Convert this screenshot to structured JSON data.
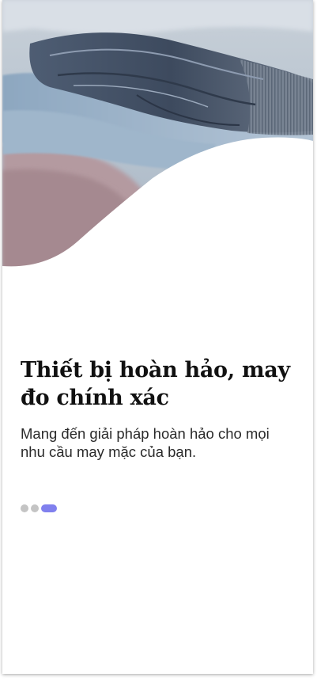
{
  "onboarding": {
    "title": "Thiết bị hoàn hảo, may đo chính xác",
    "subtitle": "Mang đến giải pháp hoàn hảo cho mọi nhu cầu may mặc của bạn.",
    "page_indicator": {
      "total": 3,
      "active_index": 2
    }
  },
  "hero_image": {
    "subject": "stacked-denim-fabrics-photo"
  },
  "colors": {
    "background": "#ffffff",
    "title": "#111111",
    "subtitle": "#2a2a2a",
    "dot_inactive": "#c4c4c4",
    "dot_active": "#8080ee"
  }
}
